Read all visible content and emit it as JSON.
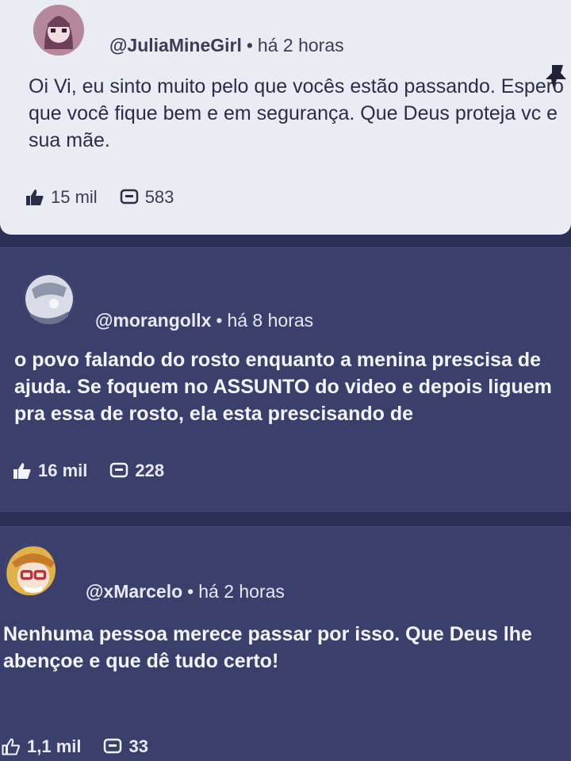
{
  "comments": [
    {
      "author": "@JuliaMineGirl",
      "time": "há 2 horas",
      "text": "Oi Vi, eu sinto muito pelo que vocês estão passando. Espero que você fique bem e em segurança. Que Deus proteja vc e sua mãe.",
      "likes": "15 mil",
      "replies": "583",
      "pinned": true
    },
    {
      "author": "@morangollx",
      "time": "há 8 horas",
      "text": "o povo falando do rosto enquanto a menina prescisa de ajuda. Se foquem no ASSUNTO do video e depois liguem pra essa de rosto, ela esta prescisando de",
      "likes": "16 mil",
      "replies": "228"
    },
    {
      "author": "@xMarcelo",
      "time": "há 2 horas",
      "text": "Nenhuma pessoa merece passar por isso. Que Deus lhe abençoe e que dê tudo certo!",
      "likes": "1,1 mil",
      "replies": "33"
    }
  ],
  "separator": "•",
  "icons": {
    "like": "thumbs-up-icon",
    "reply": "comment-icon",
    "pin": "pin-icon"
  },
  "colors": {
    "background": "#2c2f55",
    "card_light": "#eaecf3",
    "card_dark": "#3b3f6b"
  }
}
